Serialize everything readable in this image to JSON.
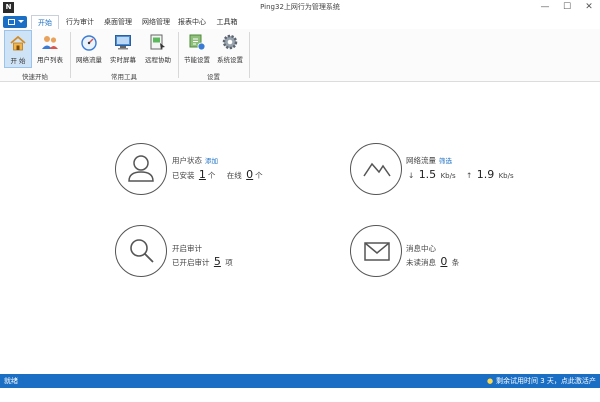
{
  "window": {
    "app_icon": "N",
    "title": "Ping32上网行为管理系统",
    "minimize": "—",
    "maximize": "☐",
    "close": "✕"
  },
  "tabs": [
    "开始",
    "行为审计",
    "桌面管理",
    "网络管理",
    "报表中心",
    "工具箱"
  ],
  "ribbon": {
    "groups": [
      {
        "label": "快速开始",
        "items": [
          "开 始",
          "用户列表"
        ]
      },
      {
        "label": "常用工具",
        "items": [
          "网络流量",
          "实时屏幕",
          "远程协助"
        ]
      },
      {
        "label": "设置",
        "items": [
          "节能设置",
          "系统设置"
        ]
      }
    ]
  },
  "cards": {
    "user_status": {
      "title": "用户状态",
      "link": "添加",
      "installed_label": "已安装",
      "installed": "1",
      "unit1": "个",
      "online_label": "在线",
      "online": "0",
      "unit2": "个"
    },
    "network": {
      "title": "网络流量",
      "link": "筛选",
      "down_arrow": "↓",
      "down": "1.5",
      "down_unit": "Kb/s",
      "up_arrow": "↑",
      "up": "1.9",
      "up_unit": "Kb/s"
    },
    "audit": {
      "title": "开启审计",
      "label": "已开启审计",
      "count": "5",
      "unit": "项"
    },
    "messages": {
      "title": "消息中心",
      "label": "未读消息",
      "count": "0",
      "unit": "条"
    }
  },
  "statusbar": {
    "left": "就绪",
    "right": "剩余试用时间 3 天，点此激活产品。"
  },
  "icons": {
    "start": "home-icon",
    "users": "users-icon",
    "traffic": "gauge-icon",
    "screen": "monitor-icon",
    "remote": "remote-icon",
    "power": "power-settings-icon",
    "settings": "gear-icon",
    "user_status": "person-icon",
    "network": "line-chart-icon",
    "audit": "magnifier-icon",
    "messages": "envelope-icon",
    "status_tip": "lightbulb-icon"
  }
}
